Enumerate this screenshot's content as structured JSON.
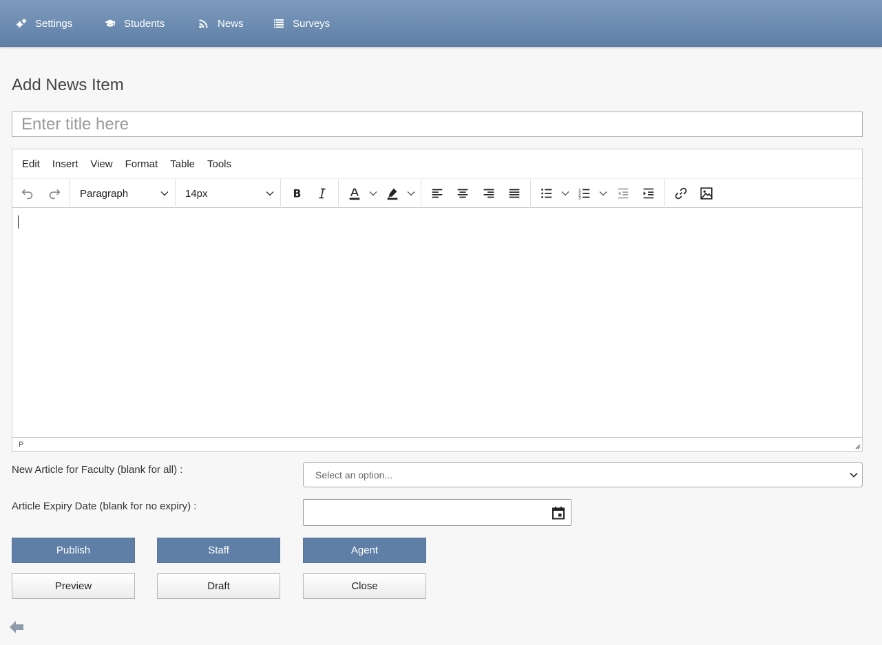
{
  "nav": {
    "items": [
      {
        "label": "Settings",
        "icon": "gears-icon"
      },
      {
        "label": "Students",
        "icon": "graduation-cap-icon"
      },
      {
        "label": "News",
        "icon": "rss-icon"
      },
      {
        "label": "Surveys",
        "icon": "list-icon"
      }
    ]
  },
  "page": {
    "title": "Add News Item",
    "title_placeholder": "Enter title here"
  },
  "editor": {
    "menu": [
      "Edit",
      "Insert",
      "View",
      "Format",
      "Table",
      "Tools"
    ],
    "block_format": "Paragraph",
    "font_size": "14px",
    "status_path": "P"
  },
  "form": {
    "faculty_label": "New Article for Faculty (blank for all) :",
    "faculty_placeholder": "Select an option...",
    "expiry_label": "Article Expiry Date (blank for no expiry) :",
    "expiry_value": ""
  },
  "buttons": {
    "publish": "Publish",
    "staff": "Staff",
    "agent": "Agent",
    "preview": "Preview",
    "draft": "Draft",
    "close": "Close"
  },
  "colors": {
    "nav_bg": "#6a89b0",
    "primary_button": "#5f7fa7",
    "page_bg": "#f7f7f7"
  }
}
